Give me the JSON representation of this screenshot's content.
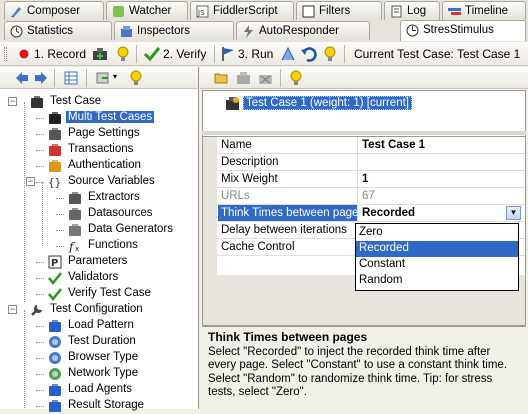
{
  "tabs_row1": [
    {
      "label": "Composer",
      "icon": "composer-icon"
    },
    {
      "label": "Watcher",
      "icon": "watcher-icon"
    },
    {
      "label": "FiddlerScript",
      "icon": "fiddlerscript-icon"
    },
    {
      "label": "Filters",
      "icon": "filters-icon"
    },
    {
      "label": "Log",
      "icon": "log-icon"
    },
    {
      "label": "Timeline",
      "icon": "timeline-icon"
    }
  ],
  "tabs_row2": [
    {
      "label": "Statistics",
      "icon": "statistics-icon"
    },
    {
      "label": "Inspectors",
      "icon": "inspectors-icon"
    },
    {
      "label": "AutoResponder",
      "icon": "autoresponder-icon"
    },
    {
      "label": "StresStimulus",
      "icon": "stresstimulus-icon",
      "active": true
    }
  ],
  "toolbar": {
    "record": "1. Record",
    "verify": "2. Verify",
    "run": "3. Run",
    "current_test_case": "Current Test Case: Test Case 1"
  },
  "tree": [
    {
      "label": "Test Case",
      "level": 0,
      "exp": "-",
      "icon": "test-case-icon"
    },
    {
      "label": "Multi Test Cases",
      "level": 1,
      "icon": "multi-test-cases-icon",
      "selected": true
    },
    {
      "label": "Page Settings",
      "level": 1,
      "icon": "page-settings-icon"
    },
    {
      "label": "Transactions",
      "level": 1,
      "icon": "transactions-icon"
    },
    {
      "label": "Authentication",
      "level": 1,
      "icon": "authentication-icon"
    },
    {
      "label": "Source Variables",
      "level": 1,
      "exp": "-",
      "icon": "source-variables-icon"
    },
    {
      "label": "Extractors",
      "level": 2,
      "icon": "extractors-icon"
    },
    {
      "label": "Datasources",
      "level": 2,
      "icon": "datasources-icon"
    },
    {
      "label": "Data Generators",
      "level": 2,
      "icon": "data-generators-icon"
    },
    {
      "label": "Functions",
      "level": 2,
      "icon": "functions-icon"
    },
    {
      "label": "Parameters",
      "level": 1,
      "icon": "parameters-icon"
    },
    {
      "label": "Validators",
      "level": 1,
      "icon": "validators-icon"
    },
    {
      "label": "Verify Test Case",
      "level": 1,
      "icon": "verify-test-case-icon"
    },
    {
      "label": "Test Configuration",
      "level": 0,
      "exp": "-",
      "icon": "test-configuration-icon"
    },
    {
      "label": "Load Pattern",
      "level": 1,
      "icon": "load-pattern-icon"
    },
    {
      "label": "Test Duration",
      "level": 1,
      "icon": "test-duration-icon"
    },
    {
      "label": "Browser Type",
      "level": 1,
      "icon": "browser-type-icon"
    },
    {
      "label": "Network Type",
      "level": 1,
      "icon": "network-type-icon"
    },
    {
      "label": "Load Agents",
      "level": 1,
      "icon": "load-agents-icon"
    },
    {
      "label": "Result Storage",
      "level": 1,
      "icon": "result-storage-icon"
    }
  ],
  "test_case_list": [
    "Test Case 1 (weight: 1) [current]"
  ],
  "properties": [
    {
      "name": "Name",
      "value": "Test Case 1",
      "bold": true
    },
    {
      "name": "Description",
      "value": ""
    },
    {
      "name": "Mix Weight",
      "value": "1",
      "bold": true
    },
    {
      "name": "URLs",
      "value": "67",
      "gray": true
    },
    {
      "name": "Think Times between pages",
      "value": "Recorded",
      "bold": true,
      "highlight": true,
      "dropdown": true
    },
    {
      "name": "Delay between iterations",
      "value": ""
    },
    {
      "name": "Cache Control",
      "value": ""
    }
  ],
  "dropdown_options": [
    "Zero",
    "Recorded",
    "Constant",
    "Random"
  ],
  "dropdown_selected": "Recorded",
  "help": {
    "title": "Think Times between pages",
    "text": "Select \"Recorded\" to inject the recorded think time after every page. Select \"Constant\" to use a constant think time. Select \"Random\" to randomize think time. Tip: for stress tests, select \"Zero\"."
  },
  "colors": {
    "selection": "#316ac5",
    "panel": "#f0efe8"
  }
}
